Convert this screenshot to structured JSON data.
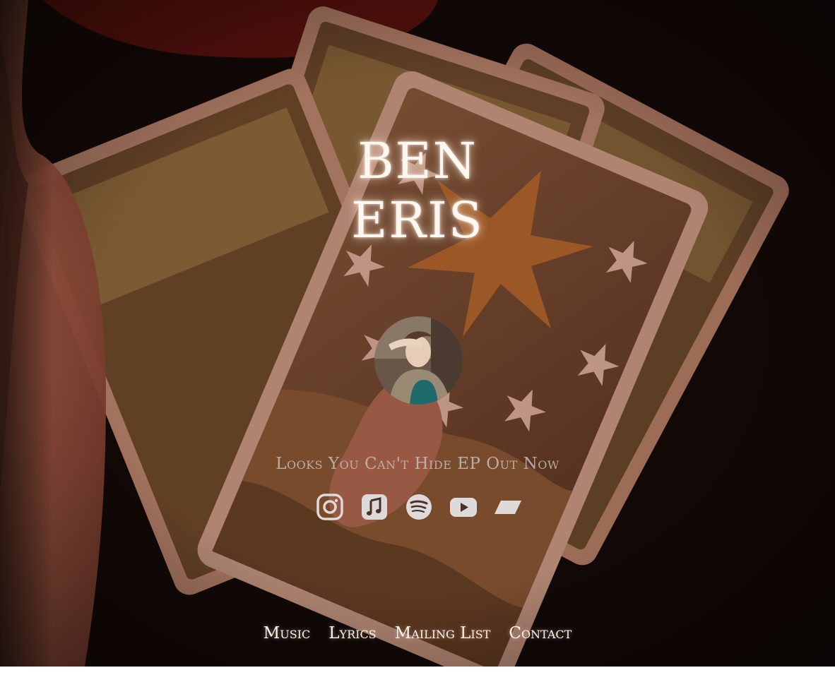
{
  "artist": {
    "name_line1": "BEN",
    "name_line2": "ERIS"
  },
  "tagline": "Looks You Can't Hide EP Out Now",
  "socials": [
    {
      "name": "instagram",
      "icon": "instagram-icon"
    },
    {
      "name": "apple-music",
      "icon": "apple-music-icon"
    },
    {
      "name": "spotify",
      "icon": "spotify-icon"
    },
    {
      "name": "youtube",
      "icon": "youtube-icon"
    },
    {
      "name": "bandcamp",
      "icon": "bandcamp-icon"
    }
  ],
  "nav": {
    "music": "Music",
    "lyrics": "Lyrics",
    "mailing_list": "Mailing List",
    "contact": "Contact"
  },
  "colors": {
    "background": "#0d0807",
    "title": "#fff7f0",
    "icon": "#dedada",
    "nav_text": "#fff4ec",
    "tagline": "#c9bdb6"
  }
}
